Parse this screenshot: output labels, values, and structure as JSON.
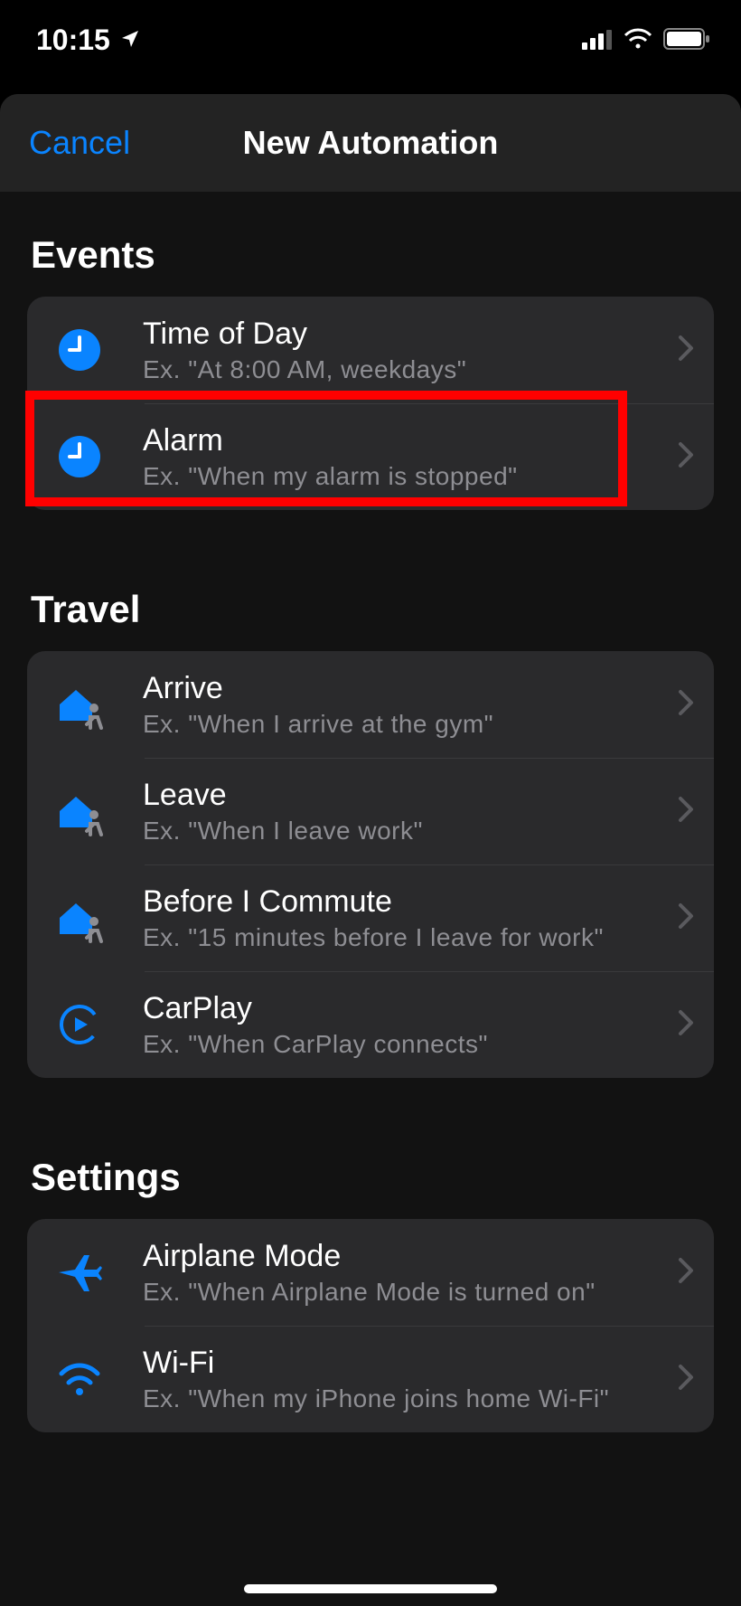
{
  "status": {
    "time": "10:15"
  },
  "header": {
    "cancel": "Cancel",
    "title": "New Automation"
  },
  "sections": {
    "events": {
      "header": "Events",
      "items": [
        {
          "title": "Time of Day",
          "sub": "Ex. \"At 8:00 AM, weekdays\""
        },
        {
          "title": "Alarm",
          "sub": "Ex. \"When my alarm is stopped\""
        }
      ]
    },
    "travel": {
      "header": "Travel",
      "items": [
        {
          "title": "Arrive",
          "sub": "Ex. \"When I arrive at the gym\""
        },
        {
          "title": "Leave",
          "sub": "Ex. \"When I leave work\""
        },
        {
          "title": "Before I Commute",
          "sub": "Ex. \"15 minutes before I leave for work\""
        },
        {
          "title": "CarPlay",
          "sub": "Ex. \"When CarPlay connects\""
        }
      ]
    },
    "settings": {
      "header": "Settings",
      "items": [
        {
          "title": "Airplane Mode",
          "sub": "Ex. \"When Airplane Mode is turned on\""
        },
        {
          "title": "Wi-Fi",
          "sub": "Ex. \"When my iPhone joins home Wi-Fi\""
        }
      ]
    }
  },
  "highlight": {
    "section": "events",
    "index": 1
  }
}
